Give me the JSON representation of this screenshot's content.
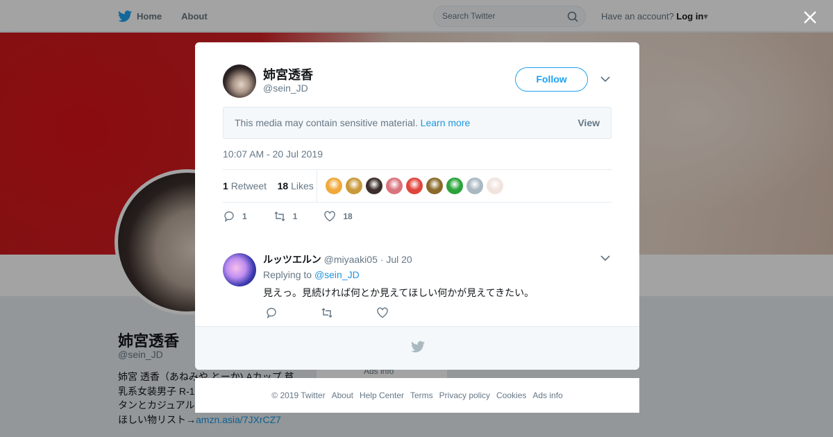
{
  "nav": {
    "home": "Home",
    "about": "About"
  },
  "search": {
    "placeholder": "Search Twitter"
  },
  "account": {
    "prompt": "Have an account?",
    "login": "Log in"
  },
  "profile": {
    "name": "姉宮透香",
    "handle": "@sein_JD",
    "bio_lines": [
      "姉宮 透香（あねみや とーか) Aカップ 貧",
      "乳系女装男子 R-1",
      "タンとカジュアル",
      "ほしい物リスト→"
    ],
    "bio_link": "amzn.asia/7JXrCZ7",
    "ads_info": "Ads info"
  },
  "tweet": {
    "author_name": "姉宮透香",
    "author_handle": "@sein_JD",
    "follow_label": "Follow",
    "sensitive_text": "This media may contain sensitive material.",
    "learn_more": "Learn more",
    "view_label": "View",
    "timestamp": "10:07 AM - 20 Jul 2019",
    "retweet_count": "1",
    "retweet_label": "Retweet",
    "like_count": "18",
    "like_label": "Likes",
    "reply_action_count": "1",
    "retweet_action_count": "1",
    "like_action_count": "18",
    "liker_colors": [
      "#f0a93a",
      "#c99a3c",
      "#3b2e2a",
      "#d9737c",
      "#e0453c",
      "#8a6a2a",
      "#2aa33a",
      "#aab8c2",
      "#f1e4de"
    ]
  },
  "reply": {
    "author_name": "ルッツエルン",
    "author_handle": "@miyaaki05",
    "date": "· Jul 20",
    "replying_to_label": "Replying to",
    "replying_to_handle": "@sein_JD",
    "text": "見えっ。見続ければ何とか見えてほしい何かが見えてきたい。"
  },
  "footer": {
    "links": [
      "© 2019 Twitter",
      "About",
      "Help Center",
      "Terms",
      "Privacy policy",
      "Cookies",
      "Ads info"
    ]
  },
  "colors": {
    "accent": "#1da1f2",
    "link": "#1b95e0",
    "muted": "#657786"
  }
}
